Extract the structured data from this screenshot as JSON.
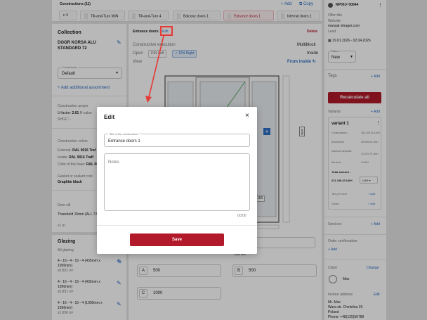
{
  "construction_bar": {
    "title": "Constructions (11)",
    "add": "+ Add",
    "copy": "Copy",
    "tabs": [
      {
        "label": "n 3",
        "active": false
      },
      {
        "label": "Tilt-and-Turn WIN",
        "active": false
      },
      {
        "label": "Tilt-and-Turn 4",
        "active": false
      },
      {
        "label": "Balcony doors 1",
        "active": false
      },
      {
        "label": "Entrance doors 1",
        "active": true
      },
      {
        "label": "Internal doors 1",
        "active": false
      }
    ]
  },
  "left": {
    "collection_title": "Collection",
    "collection_name": "DOOR KORSA ALU STANDARD 72",
    "constructor_label": "Constructor",
    "constructor_value": "Default",
    "add_assortment": "Add additional assortment",
    "construction_props": "Construction proper",
    "u_factor_label": "U-factor:",
    "u_factor_value": "2.01",
    "r_value": "R-value",
    "shgc": "SHGC: -",
    "colors_title": "Construction colors",
    "external_label": "External:",
    "external_value": "RAL 9016 Traf",
    "inside_label": "Inside:",
    "inside_value": "RAL 9016 Traff",
    "base_color_label": "Color of the base:",
    "base_color_value": "RAL 9016 white",
    "gasket_label": "Gasket or sealant colo",
    "gasket_value": "Graphite black",
    "door_sill": "Door sill",
    "threshold": "Threshold 15mm (ALL 72)",
    "threshold_qty": "x1 m",
    "glazing_title": "Glazing",
    "all_glazing": "All glazing",
    "glazing_items": [
      {
        "spec": "4 - 16 - 4 - 16 - 4 (435mm x 1956mm)",
        "area": "x0.851 m²"
      },
      {
        "spec": "4 - 16 - 4 - 16 - 4 (435mm x 1956mm)",
        "area": "x0.851 m²"
      },
      {
        "spec": "4 - 16 - 4 - 16 - 4 (1000mm x 1956mm)",
        "area": "x1.956 m²"
      }
    ]
  },
  "center": {
    "title": "Entrance doors 1",
    "edit": "Edit",
    "delete": "Delete",
    "exec_label": "Constructive execution",
    "exec_value": "Multiblock",
    "open_label": "Open",
    "open_left": "DIN Left",
    "open_right": "DIN Right",
    "open_value": "Inside",
    "view_label": "View",
    "view_value": "From inside",
    "dim_right": "2060",
    "dim_sill": "150",
    "dim_bottom": "1500 mm",
    "inputs": [
      {
        "key": "A",
        "value": "500"
      },
      {
        "key": "B",
        "value": "500"
      },
      {
        "key": "C",
        "value": "1000"
      }
    ]
  },
  "right": {
    "order_id": "NP00,F 00044",
    "offer_title_label": "Offer title",
    "website_label": "Website",
    "website_value": "manual vitrager.com",
    "lead_label": "Lead",
    "dates": "19.01.2026 - 02.04.2026",
    "status_label": "Status",
    "status_value": "New",
    "tags_label": "Tags",
    "add": "+ Add",
    "recalculate": "Recalculate all",
    "variants_label": "Variants",
    "variant_name": "variant 1",
    "rows": [
      {
        "label": "Constructions...",
        "value": "181,043 Kc UAH"
      },
      {
        "label": "Assortment",
        "value": "26,505.93 UAH"
      },
      {
        "label": "Discount deposits",
        "value": "12,475.75 UAH"
      },
      {
        "label": "Services",
        "value": "0 UAH"
      }
    ],
    "total_label": "Total amount :",
    "total_value": "211 248.33 UAH",
    "currency": "UAH",
    "tax_label": "Tax per cent",
    "goals_label": "Goals",
    "services_label": "Services",
    "order_conf_label": "Order confirmation",
    "client_label": "Client",
    "change": "Change",
    "client_name": "Max",
    "invoice_label": "Invoice address",
    "invoice_edit": "Edit",
    "invoice_lines": [
      "Mr. Max",
      "Wara str. Chmielna 29",
      "Poland",
      "Phone: +48(125)56789"
    ]
  },
  "modal": {
    "title": "Edit",
    "close": "×",
    "field_label": "Title of the construction *",
    "field_value": "Entrance doors 1",
    "notes_placeholder": "Notes",
    "counter": "0/200",
    "save": "Save"
  },
  "colors": {
    "accent": "#b2192a",
    "link": "#2c6fc4",
    "annotation": "#e53935"
  }
}
